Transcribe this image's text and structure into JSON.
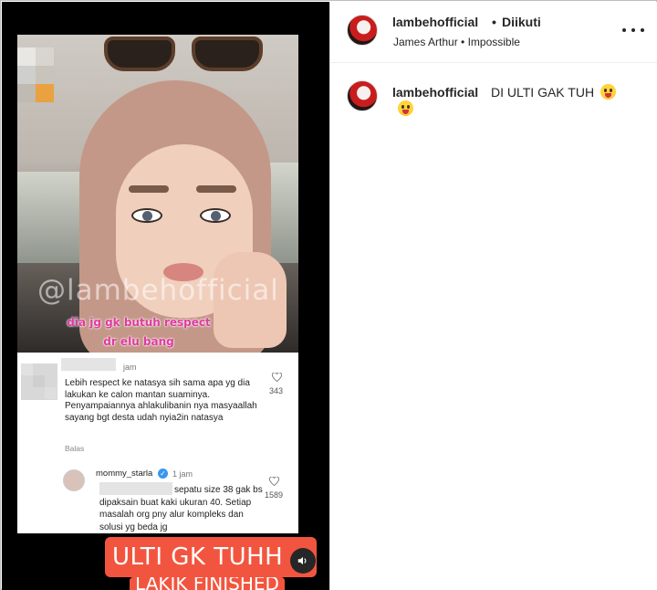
{
  "post": {
    "watermark": "@lambehofficial",
    "overlay_text": "dia jg gk butuh respect dr elu bang",
    "caption_line1": "ULTI GK TUHH",
    "caption_line2": "LAKIK FINISHED",
    "comment": {
      "time": "jam",
      "text": "Lebih respect ke natasya sih sama apa yg dia lakukan ke calon mantan suaminya. Penyampaiannya ahlakulibanin nya masyaallah sayang bgt desta udah nyia2in natasya",
      "likes": "343",
      "reply_label": "Balas"
    },
    "reply": {
      "username": "mommy_starla",
      "verified_mark": "✓",
      "time": "1 jam",
      "text": "sepatu size 38 gak bs dipaksain buat kaki ukuran 40. Setiap masalah org pny alur kompleks dan solusi yg beda jg",
      "likes": "1589"
    }
  },
  "header": {
    "username": "lambehofficial",
    "separator": "•",
    "follow_status": "Diikuti",
    "music": "James Arthur • Impossible"
  },
  "caption": {
    "username": "lambehofficial",
    "text": "DI ULTI GAK TUH"
  },
  "icons": {
    "more": "more-options-icon",
    "sound": "speaker-icon",
    "like": "heart-icon",
    "emoji": "tongue-wink-emoji"
  },
  "colors": {
    "caption_bg": "#f2553f",
    "overlay_text": "#e03aa0",
    "verified": "#3897f0"
  }
}
